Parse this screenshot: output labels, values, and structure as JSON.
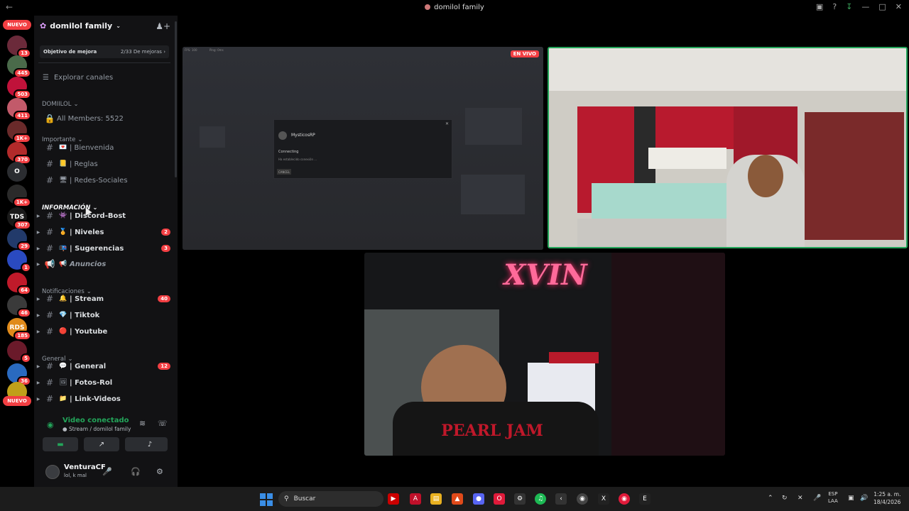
{
  "window": {
    "title": "domilol family"
  },
  "server_list": {
    "top_badge": "NUEVO",
    "bottom_badge": "NUEVO",
    "servers": [
      {
        "name": "server-1",
        "count": "13",
        "color": "#6b2a3a"
      },
      {
        "name": "server-2",
        "count": "445",
        "color": "#4a6a4a"
      },
      {
        "name": "server-3",
        "count": "503",
        "color": "#c0123a"
      },
      {
        "name": "server-4",
        "count": "411",
        "color": "#c25a6a"
      },
      {
        "name": "server-5",
        "count": "1K+",
        "color": "#6a2a2a"
      },
      {
        "name": "server-6",
        "count": "370",
        "color": "#b22a2a"
      },
      {
        "name": "server-7",
        "count": "",
        "label": "O",
        "color": "#2b2d31"
      },
      {
        "name": "server-8",
        "count": "1K+",
        "color": "#2a2a2a"
      },
      {
        "name": "server-9",
        "count": "307",
        "label": "TDS",
        "color": "#1a1a1a"
      },
      {
        "name": "server-10",
        "count": "29",
        "color": "#223a6a"
      },
      {
        "name": "server-11",
        "count": "1",
        "color": "#2a4ac0"
      },
      {
        "name": "server-12",
        "count": "64",
        "color": "#c01a2a"
      },
      {
        "name": "server-13",
        "count": "46",
        "color": "#3a3a3a"
      },
      {
        "name": "server-14",
        "count": "185",
        "label": "RDS",
        "color": "#e08a1a"
      },
      {
        "name": "server-15",
        "count": "5",
        "color": "#6a1a2a"
      },
      {
        "name": "server-16",
        "count": "36",
        "color": "#2a6ac0"
      },
      {
        "name": "server-17",
        "count": "",
        "color": "#c0a01a"
      }
    ]
  },
  "sidebar": {
    "server_name": "domilol family",
    "goal_label": "Objetivo de mejora",
    "goal_progress": "2/33 De mejoras",
    "explore": "Explorar canales",
    "categories": [
      {
        "label": "DOMIILOL",
        "items": [
          {
            "label": "All Members: 5522",
            "type": "lock"
          }
        ]
      },
      {
        "label": "Importante",
        "items": [
          {
            "label": "| Bienvenida",
            "emoji": "💌"
          },
          {
            "label": "| Reglas",
            "emoji": "📒"
          },
          {
            "label": "| Redes-Sociales",
            "emoji": "🖥"
          }
        ]
      },
      {
        "label": "INFORMACIÓN",
        "items": [
          {
            "label": "| Discord-Bost",
            "emoji": "👾",
            "badge": ""
          },
          {
            "label": "| Niveles",
            "emoji": "🏅",
            "badge": "2"
          },
          {
            "label": "| Sugerencias",
            "emoji": "📭",
            "badge": "3"
          },
          {
            "label": "Anuncios",
            "emoji": "📢",
            "badge": ""
          }
        ]
      },
      {
        "label": "Notificaciones",
        "items": [
          {
            "label": "| Stream",
            "emoji": "🔔",
            "badge": "40"
          },
          {
            "label": "| Tiktok",
            "emoji": "💎",
            "badge": ""
          },
          {
            "label": "| Youtube",
            "emoji": "🔴",
            "badge": ""
          }
        ]
      },
      {
        "label": "General",
        "items": [
          {
            "label": "| General",
            "emoji": "💬",
            "badge": "12"
          },
          {
            "label": "| Fotos-Rol",
            "emoji": "🖼",
            "badge": ""
          },
          {
            "label": "| Link-Videos",
            "emoji": "📁",
            "badge": ""
          }
        ]
      }
    ]
  },
  "voice": {
    "status": "Video conectado",
    "channel": "Stream / domilol family"
  },
  "user": {
    "name": "VenturaCF",
    "status": "lol, k mal"
  },
  "stage": {
    "live_label": "EN VIVO",
    "dialog": {
      "title": "MysticosRP",
      "status": "Connecting",
      "sub": "Ha establecido conexión ...",
      "button": "CANCEL"
    },
    "ss_top_left": "FPS: 100",
    "ss_top_left2": "Ping: 0ms",
    "neon_text": "XVIN",
    "shirt_text": "PEARL JAM"
  },
  "taskbar": {
    "search_placeholder": "Buscar",
    "lang_1": "ESP",
    "lang_2": "LAA",
    "time": "1:25 a. m.",
    "date": "18/4/2026"
  },
  "colors": {
    "accent_green": "#23a55a",
    "badge_red": "#f23f43",
    "bg_sidebar": "#121214"
  }
}
